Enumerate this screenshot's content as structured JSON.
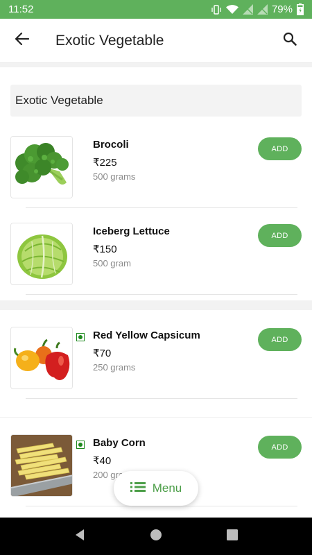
{
  "status_bar": {
    "time": "11:52",
    "battery": "79%"
  },
  "header": {
    "title": "Exotic Vegetable"
  },
  "section": {
    "title": "Exotic Vegetable"
  },
  "items": [
    {
      "name": "Brocoli",
      "price": "₹225",
      "quantity": "500 grams",
      "add_label": "ADD",
      "veg_mark": false
    },
    {
      "name": "Iceberg Lettuce",
      "price": "₹150",
      "quantity": "500 gram",
      "add_label": "ADD",
      "veg_mark": false
    },
    {
      "name": "Red Yellow Capsicum",
      "price": "₹70",
      "quantity": "250 grams",
      "add_label": "ADD",
      "veg_mark": true
    },
    {
      "name": "Baby Corn",
      "price": "₹40",
      "quantity": "200 grams",
      "add_label": "ADD",
      "veg_mark": true
    }
  ],
  "menu_button": {
    "label": "Menu"
  },
  "colors": {
    "brand_green": "#5fb15c",
    "veg_green": "#1e8a1e"
  }
}
